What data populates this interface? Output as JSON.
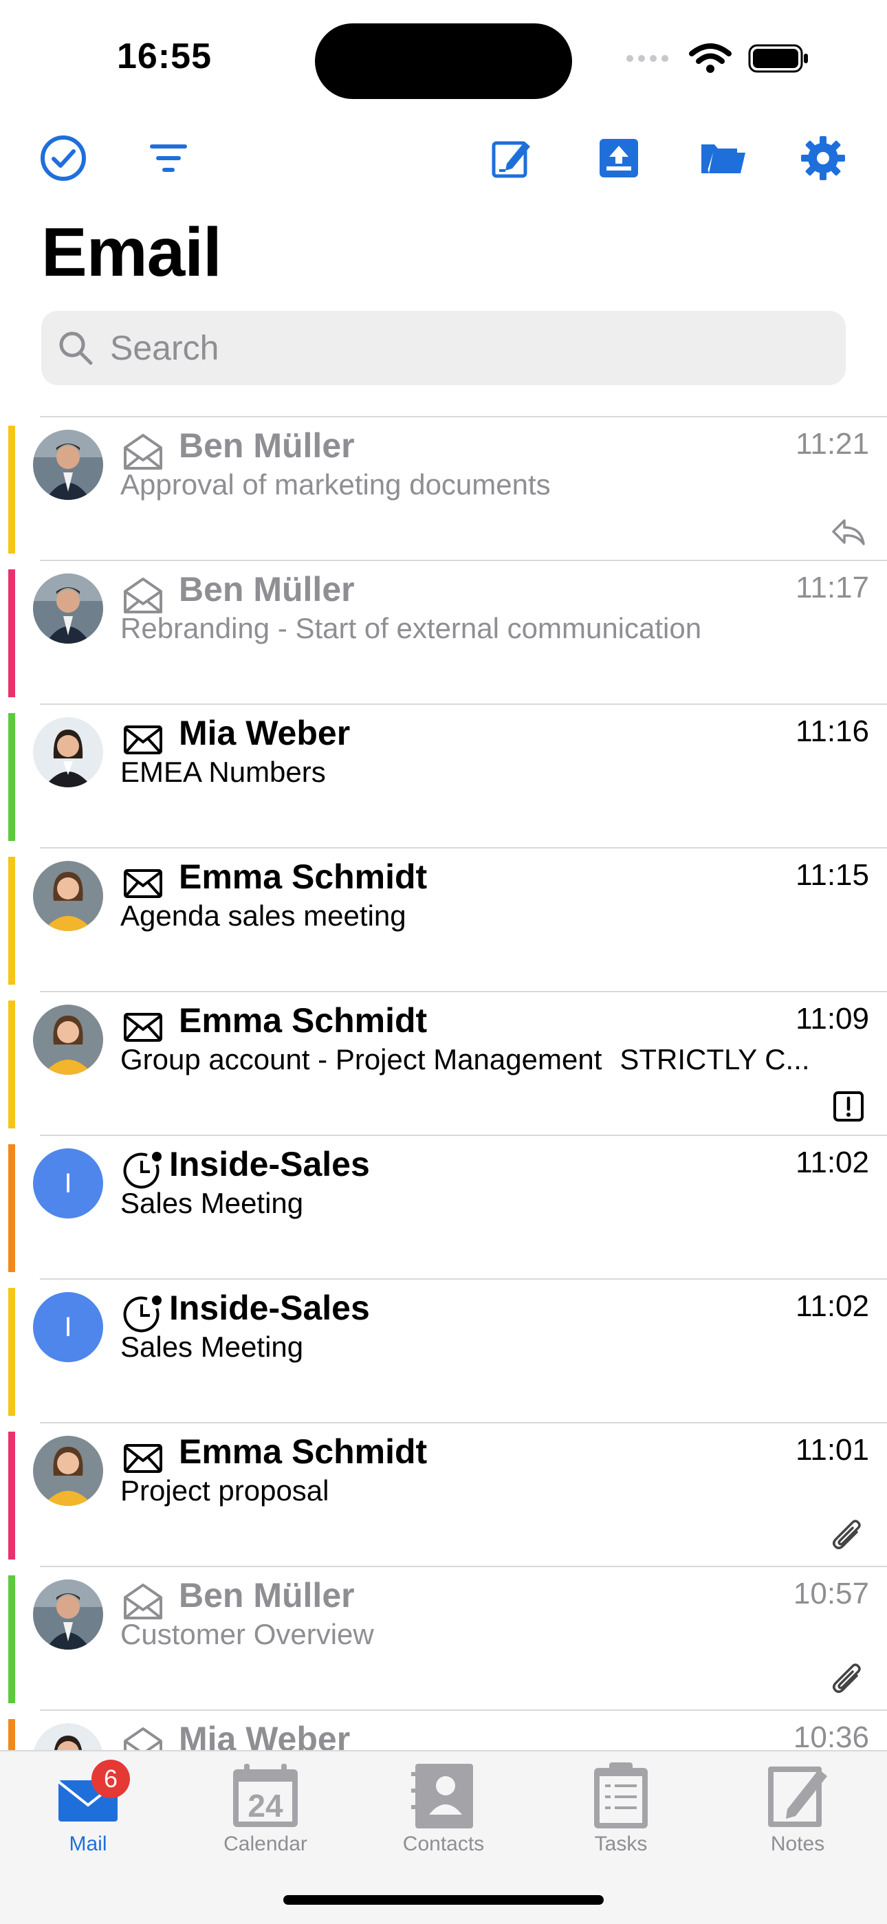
{
  "status_bar": {
    "time": "16:55"
  },
  "toolbar": {
    "icons": [
      "checkmark-circle-icon",
      "filter-icon",
      "compose-icon",
      "inbox-upload-icon",
      "folder-icon",
      "gear-icon"
    ]
  },
  "page": {
    "title": "Email"
  },
  "search": {
    "placeholder": "Search"
  },
  "colors": {
    "accent": "#1f6fdb",
    "yellow": "#f5c518",
    "pink": "#e8336d",
    "green": "#5ccb3a",
    "orange": "#f08a1c",
    "avatar_blue": "#4f86ec"
  },
  "emails": [
    {
      "sender": "Ben Müller",
      "subject": "Approval of marketing documents",
      "subject_extra": "",
      "time": "11:21",
      "read": true,
      "status_icon": "envelope-open-icon",
      "category_color": "#f5c518",
      "avatar": "ben",
      "corner_icon": "reply-icon"
    },
    {
      "sender": "Ben Müller",
      "subject": "Rebranding - Start of external communication",
      "subject_extra": "",
      "time": "11:17",
      "read": true,
      "status_icon": "envelope-open-icon",
      "category_color": "#e8336d",
      "avatar": "ben",
      "corner_icon": ""
    },
    {
      "sender": "Mia Weber",
      "subject": "EMEA Numbers",
      "subject_extra": "",
      "time": "11:16",
      "read": false,
      "status_icon": "envelope-closed-icon",
      "category_color": "#5ccb3a",
      "avatar": "mia",
      "corner_icon": ""
    },
    {
      "sender": "Emma Schmidt",
      "subject": "Agenda sales meeting",
      "subject_extra": "",
      "time": "11:15",
      "read": false,
      "status_icon": "envelope-closed-icon",
      "category_color": "#f5c518",
      "avatar": "emma",
      "corner_icon": ""
    },
    {
      "sender": "Emma Schmidt",
      "subject": "Group account - Project Management",
      "subject_extra": "STRICTLY C...",
      "time": "11:09",
      "read": false,
      "status_icon": "envelope-closed-icon",
      "category_color": "#f5c518",
      "avatar": "emma",
      "corner_icon": "important-icon"
    },
    {
      "sender": "Inside-Sales",
      "subject": "Sales Meeting",
      "subject_extra": "",
      "time": "11:02",
      "read": false,
      "status_icon": "clock-invite-icon",
      "category_color": "#f08a1c",
      "avatar": "initial",
      "avatar_initial": "I",
      "corner_icon": ""
    },
    {
      "sender": "Inside-Sales",
      "subject": "Sales Meeting",
      "subject_extra": "",
      "time": "11:02",
      "read": false,
      "status_icon": "clock-invite-icon",
      "category_color": "#f5c518",
      "avatar": "initial",
      "avatar_initial": "I",
      "corner_icon": ""
    },
    {
      "sender": "Emma Schmidt",
      "subject": "Project proposal",
      "subject_extra": "",
      "time": "11:01",
      "read": false,
      "status_icon": "envelope-closed-icon",
      "category_color": "#e8336d",
      "avatar": "emma",
      "corner_icon": "paperclip-icon"
    },
    {
      "sender": "Ben Müller",
      "subject": "Customer Overview",
      "subject_extra": "",
      "time": "10:57",
      "read": true,
      "status_icon": "envelope-open-icon",
      "category_color": "#5ccb3a",
      "avatar": "ben",
      "corner_icon": "paperclip-icon"
    },
    {
      "sender": "Mia Weber",
      "subject": "",
      "subject_extra": "",
      "time": "10:36",
      "read": true,
      "status_icon": "envelope-open-icon",
      "category_color": "#f08a1c",
      "avatar": "mia",
      "corner_icon": ""
    }
  ],
  "tabs": [
    {
      "label": "Mail",
      "icon": "mail-icon",
      "active": true,
      "badge": "6"
    },
    {
      "label": "Calendar",
      "icon": "calendar-icon",
      "active": false,
      "day": "24"
    },
    {
      "label": "Contacts",
      "icon": "contacts-icon",
      "active": false
    },
    {
      "label": "Tasks",
      "icon": "tasks-icon",
      "active": false
    },
    {
      "label": "Notes",
      "icon": "notes-icon",
      "active": false
    }
  ]
}
